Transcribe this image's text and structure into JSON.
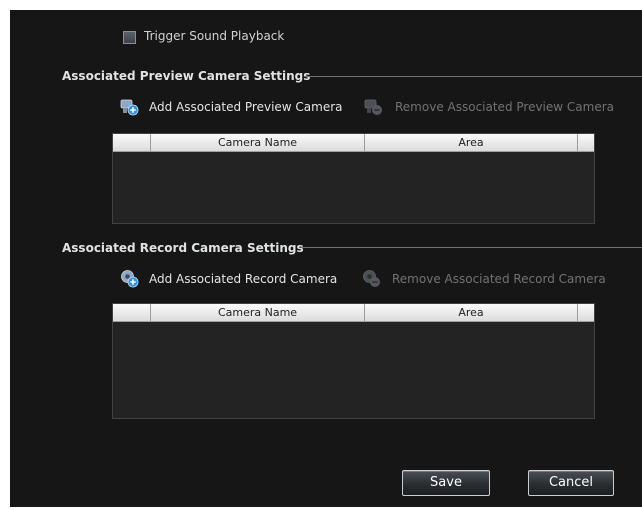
{
  "trigger_sound": {
    "label": "Trigger Sound Playback",
    "checked": false
  },
  "preview_section": {
    "title": "Associated Preview Camera Settings",
    "add_label": "Add Associated Preview Camera",
    "remove_label": "Remove Associated Preview Camera",
    "columns": [
      "Camera Name",
      "Area"
    ],
    "rows": []
  },
  "record_section": {
    "title": "Associated Record  Camera Settings",
    "add_label": "Add Associated Record Camera",
    "remove_label": "Remove Associated Record Camera",
    "columns": [
      "Camera Name",
      "Area"
    ],
    "rows": []
  },
  "footer": {
    "save_label": "Save",
    "cancel_label": "Cancel"
  },
  "colors": {
    "panel_bg": "#161616",
    "grid_bg": "#232323",
    "add_icon_accent": "#2f8fe0"
  }
}
